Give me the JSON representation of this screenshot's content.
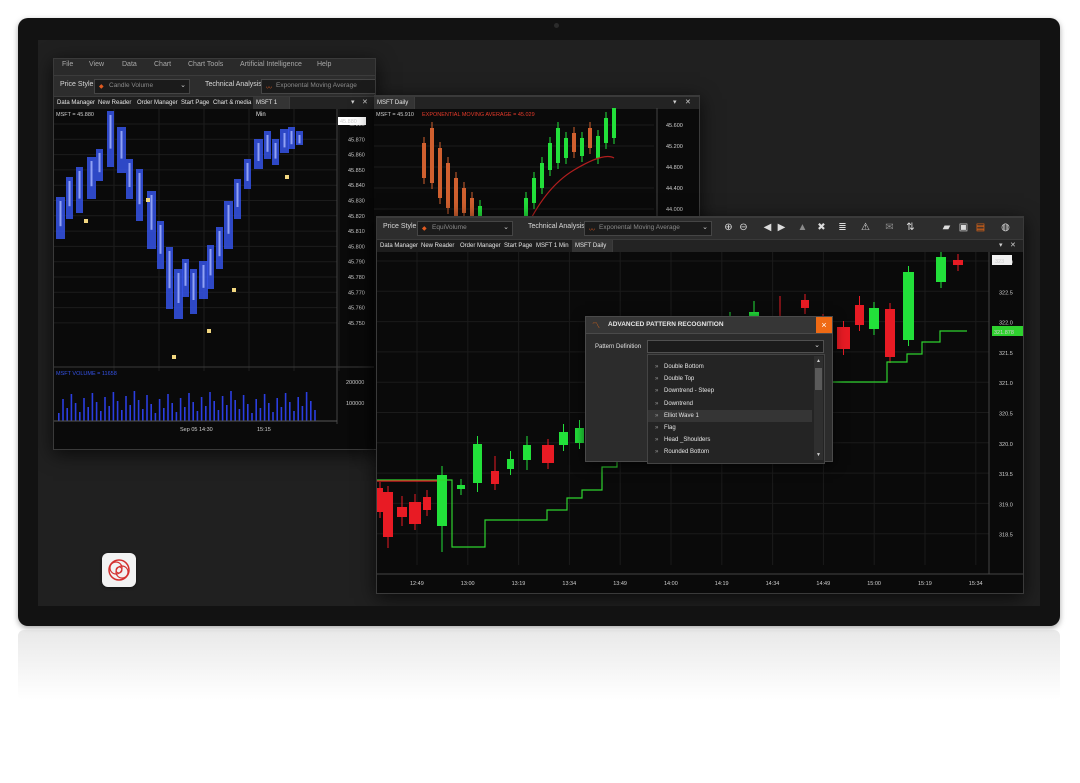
{
  "menu": [
    "File",
    "View",
    "Data",
    "Chart",
    "Chart Tools",
    "Artificial Intelligence",
    "Help"
  ],
  "win1": {
    "price_style_label": "Price Style",
    "price_style_value": "Candle Volume",
    "tech_label": "Technical Analysis",
    "tech_value": "Exponental Moving Average",
    "tabs": [
      "Data Manager",
      "New Reader",
      "Order Manager",
      "Start Page",
      "Chart & media",
      "MSFT 1 Min"
    ],
    "tab2": "MSFT Daily",
    "left_chart": {
      "title": "MSFT = 45.880",
      "price_box": "45.880",
      "yticks": [
        "45.880",
        "45.870",
        "45.860",
        "45.850",
        "45.840",
        "45.830",
        "45.820",
        "45.810",
        "45.800",
        "45.790",
        "45.780",
        "45.770",
        "45.760",
        "45.750"
      ],
      "volume_title": "MSFT VOLUME = 11658",
      "vol_ticks": [
        "200000",
        "100000"
      ],
      "xticks": [
        "Sep 05 14:30",
        "15:15"
      ]
    },
    "right_chart": {
      "title": "MSFT = 45.910",
      "ema_label": "EXPONENTIAL MOVING AVERAGE = 45.029",
      "yticks": [
        "45.600",
        "45.200",
        "44.800",
        "44.400",
        "44.000"
      ]
    }
  },
  "win2": {
    "price_style_label": "Price Style",
    "price_style_value": "EquiVolume",
    "tech_label": "Technical Analysis",
    "tech_value": "Exponental Moving Average",
    "tabs": [
      "Data Manager",
      "New Reader",
      "Order Manager",
      "Start Page",
      "MSFT 1 Min",
      "MSFT Daily"
    ],
    "yticks": [
      "323.0",
      "322.5",
      "322.0",
      "321.5",
      "321.0",
      "320.5",
      "320.0",
      "319.5",
      "319.0",
      "318.5"
    ],
    "xticks": [
      "12:49",
      "13:00",
      "13:19",
      "13:34",
      "13:49",
      "14:00",
      "14:19",
      "14:34",
      "14:49",
      "15:00",
      "15:19",
      "15:34"
    ],
    "price_badge": "323",
    "ema_badge": "321.878"
  },
  "dialog": {
    "title": "ADVANCED PATTERN RECOGNITION",
    "label": "Pattern Definition",
    "items": [
      "Double Bottom",
      "Double Top",
      "Downtrend - Steep",
      "Downtrend",
      "Elliot Wave 1",
      "Flag",
      "Head _Shoulders",
      "Rounded Bottom"
    ],
    "close": "×"
  },
  "icons": {
    "zoom_in": "magnifier-plus-icon",
    "zoom_out": "magnifier-minus-icon",
    "back": "arrow-left-circle-icon",
    "forward": "arrow-right-circle-icon",
    "up": "triangle-up-icon",
    "cross": "cross-icon",
    "indicator": "sliders-icon",
    "alert": "alarm-icon",
    "chat": "chat-icon",
    "sort": "sort-icon",
    "open": "folder-icon",
    "save": "save-icon",
    "print": "print-icon",
    "globe": "globe-icon"
  },
  "colors": {
    "bull": "#22e03a",
    "bear": "#e81b24",
    "ema": "#2fd22f",
    "candle_blue": "#3553e8",
    "accent": "#ef6a14"
  }
}
